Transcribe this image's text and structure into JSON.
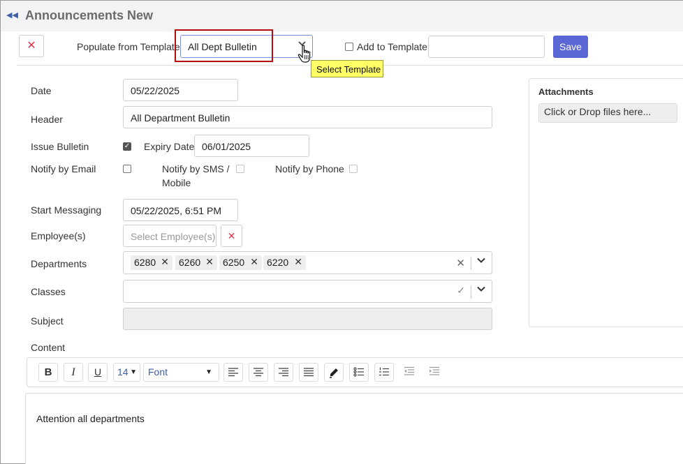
{
  "page": {
    "title": "Announcements New"
  },
  "toolbar": {
    "populate_label": "Populate from Template",
    "template_value": "All Dept Bulletin",
    "tooltip": "Select Template",
    "add_to_template_label": "Add to Template",
    "add_to_template_value": "",
    "save_label": "Save"
  },
  "form": {
    "date_label": "Date",
    "date_value": "05/22/2025",
    "header_label": "Header",
    "header_value": "All Department Bulletin",
    "issue_bulletin_label": "Issue Bulletin",
    "issue_bulletin_checked": true,
    "expiry_label": "Expiry Date",
    "expiry_value": "06/01/2025",
    "notify_email_label": "Notify by Email",
    "notify_sms_label_line1": "Notify by SMS /",
    "notify_sms_label_line2": "Mobile",
    "notify_phone_label": "Notify by Phone",
    "start_label": "Start Messaging",
    "start_value": "05/22/2025, 6:51 PM",
    "employees_label": "Employee(s)",
    "employees_placeholder": "Select Employee(s)",
    "departments_label": "Departments",
    "departments": [
      "6280",
      "6260",
      "6250",
      "6220"
    ],
    "classes_label": "Classes",
    "subject_label": "Subject",
    "subject_value": "",
    "content_label": "Content"
  },
  "attachments": {
    "title": "Attachments",
    "drop_text": "Click or Drop files here..."
  },
  "editor": {
    "bold": "B",
    "italic": "I",
    "underline": "U",
    "font_size": "14",
    "font": "Font",
    "content": "Attention all departments"
  },
  "colors": {
    "accent": "#5c67d6",
    "danger": "#e0334b",
    "highlight_border": "#b40d0d",
    "tooltip_bg": "#ffff66"
  }
}
